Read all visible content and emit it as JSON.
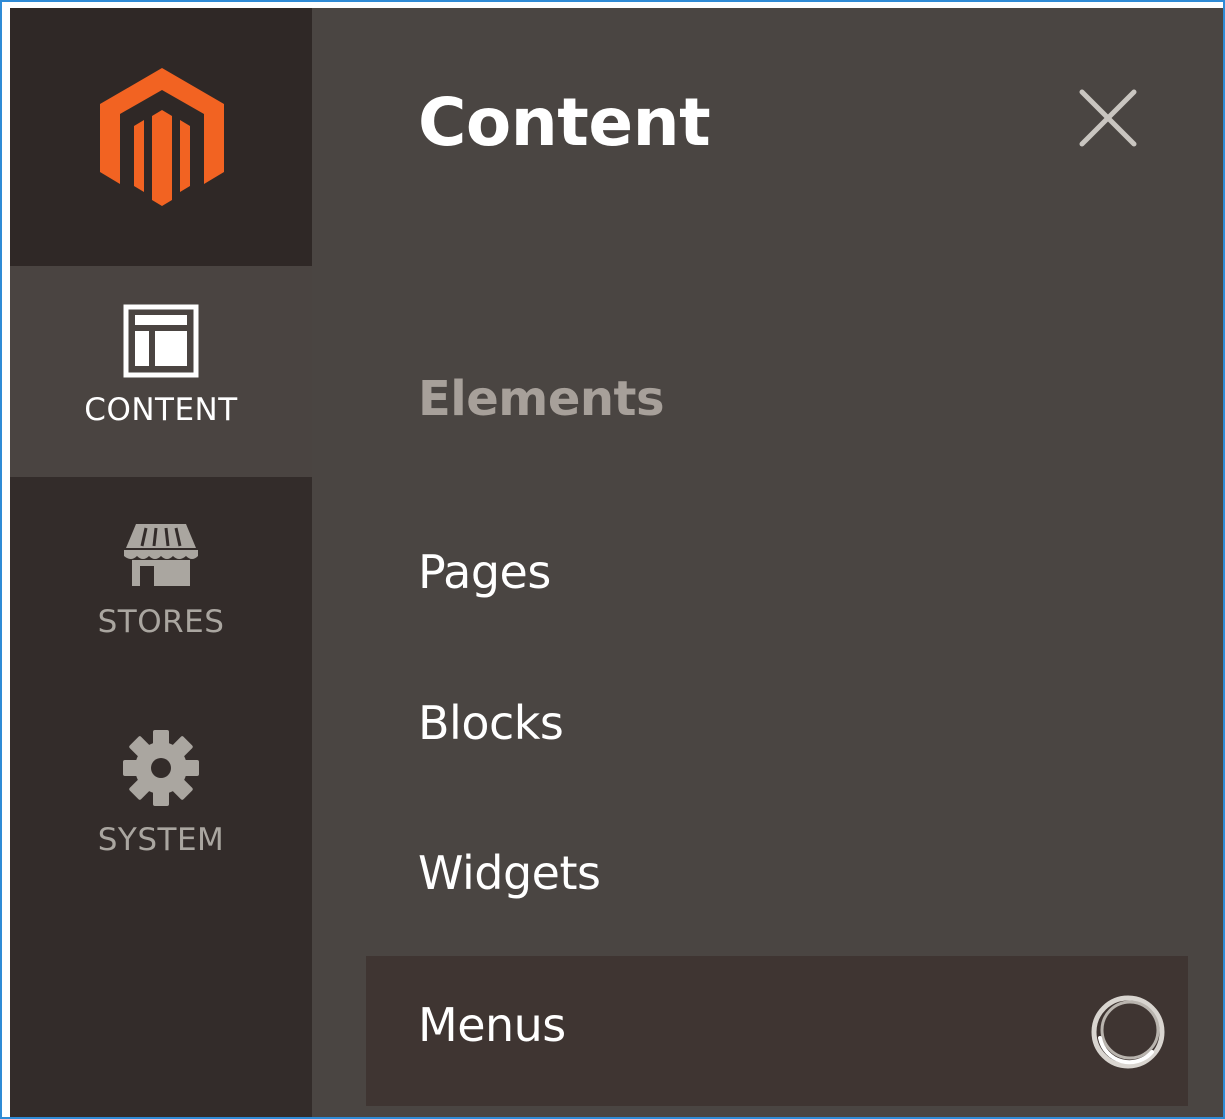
{
  "sidebar": {
    "logo": "magento-logo-icon",
    "items": [
      {
        "label": "CONTENT",
        "icon": "content-layout-icon",
        "active": true
      },
      {
        "label": "STORES",
        "icon": "storefront-icon",
        "active": false
      },
      {
        "label": "SYSTEM",
        "icon": "gear-icon",
        "active": false
      }
    ]
  },
  "panel": {
    "title": "Content",
    "close_icon": "close-icon",
    "sections": [
      {
        "title": "Elements",
        "items": [
          {
            "label": "Pages"
          },
          {
            "label": "Blocks"
          },
          {
            "label": "Widgets"
          },
          {
            "label": "Menus",
            "highlighted": true,
            "loading": true
          }
        ]
      }
    ]
  },
  "colors": {
    "brand_orange": "#f26322",
    "nav_background": "#332c2a",
    "nav_active_background": "#4a4441",
    "panel_background": "#4a4542",
    "highlight_background": "#3f3532",
    "section_title": "#a7a09a",
    "selection_border": "#2f8bd6"
  }
}
